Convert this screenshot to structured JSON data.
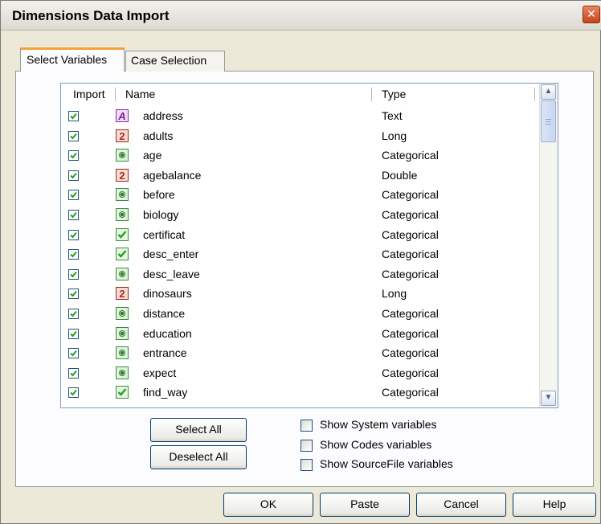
{
  "window": {
    "title": "Dimensions Data Import",
    "close_glyph": "✕"
  },
  "tabs": [
    {
      "label": "Select Variables",
      "active": true
    },
    {
      "label": "Case Selection",
      "active": false
    }
  ],
  "list": {
    "headers": {
      "import": "Import",
      "name": "Name",
      "type": "Type"
    },
    "rows": [
      {
        "checked": true,
        "icon": "text-variable-icon",
        "name": "address",
        "type": "Text"
      },
      {
        "checked": true,
        "icon": "numeric-variable-icon",
        "name": "adults",
        "type": "Long"
      },
      {
        "checked": true,
        "icon": "categorical-variable-icon",
        "name": "age",
        "type": "Categorical"
      },
      {
        "checked": true,
        "icon": "numeric-variable-icon",
        "name": "agebalance",
        "type": "Double"
      },
      {
        "checked": true,
        "icon": "categorical-variable-icon",
        "name": "before",
        "type": "Categorical"
      },
      {
        "checked": true,
        "icon": "categorical-variable-icon",
        "name": "biology",
        "type": "Categorical"
      },
      {
        "checked": true,
        "icon": "multi-response-variable-icon",
        "name": "certificat",
        "type": "Categorical"
      },
      {
        "checked": true,
        "icon": "multi-response-variable-icon",
        "name": "desc_enter",
        "type": "Categorical"
      },
      {
        "checked": true,
        "icon": "categorical-variable-icon",
        "name": "desc_leave",
        "type": "Categorical"
      },
      {
        "checked": true,
        "icon": "numeric-variable-icon",
        "name": "dinosaurs",
        "type": "Long"
      },
      {
        "checked": true,
        "icon": "categorical-variable-icon",
        "name": "distance",
        "type": "Categorical"
      },
      {
        "checked": true,
        "icon": "categorical-variable-icon",
        "name": "education",
        "type": "Categorical"
      },
      {
        "checked": true,
        "icon": "categorical-variable-icon",
        "name": "entrance",
        "type": "Categorical"
      },
      {
        "checked": true,
        "icon": "categorical-variable-icon",
        "name": "expect",
        "type": "Categorical"
      },
      {
        "checked": true,
        "icon": "multi-response-variable-icon",
        "name": "find_way",
        "type": "Categorical"
      }
    ]
  },
  "buttons": {
    "select_all": "Select All",
    "deselect_all": "Deselect All",
    "ok": "OK",
    "paste": "Paste",
    "cancel": "Cancel",
    "help": "Help"
  },
  "options": {
    "show_system": {
      "label": "Show System variables",
      "checked": false
    },
    "show_codes": {
      "label": "Show Codes variables",
      "checked": false
    },
    "show_sourcefile": {
      "label": "Show SourceFile variables",
      "checked": false
    }
  },
  "colors": {
    "dialog_bg": "#ece9d8",
    "active_tab_accent": "#f2a33c",
    "checkmark": "#21a121",
    "button_border": "#003c74"
  }
}
